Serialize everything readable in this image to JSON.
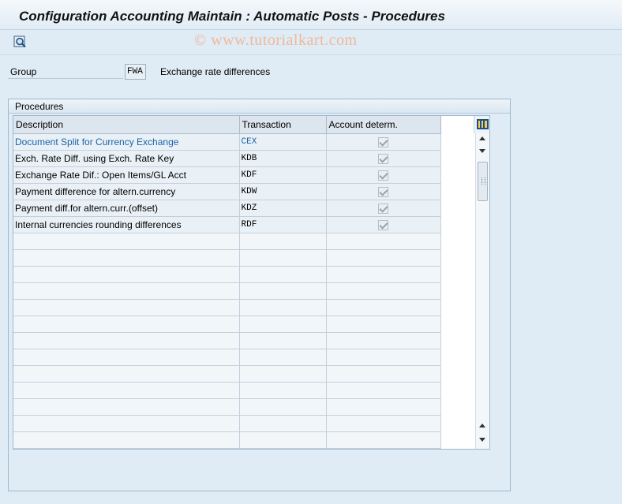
{
  "window": {
    "title": "Configuration Accounting Maintain : Automatic Posts - Procedures"
  },
  "toolbar": {
    "watermark": "© www.tutorialkart.com",
    "details_icon": "magnifier-details-icon"
  },
  "group": {
    "label": "Group",
    "value": "FWA",
    "description": "Exchange rate differences"
  },
  "procedures": {
    "title": "Procedures",
    "columns": [
      "Description",
      "Transaction",
      "Account determ."
    ],
    "rows": [
      {
        "description": "Document Split for Currency Exchange",
        "transaction": "CEX",
        "account_determ": true
      },
      {
        "description": "Exch. Rate Diff. using Exch. Rate Key",
        "transaction": "KDB",
        "account_determ": true
      },
      {
        "description": "Exchange Rate Dif.: Open Items/GL Acct",
        "transaction": "KDF",
        "account_determ": true
      },
      {
        "description": "Payment difference for altern.currency",
        "transaction": "KDW",
        "account_determ": true
      },
      {
        "description": "Payment diff.for altern.curr.(offset)",
        "transaction": "KDZ",
        "account_determ": true
      },
      {
        "description": "Internal currencies rounding differences",
        "transaction": "RDF",
        "account_determ": true
      }
    ],
    "column_settings_icon": "column-settings-icon"
  },
  "colors": {
    "link": "#1d62a6",
    "background": "#dfebf5",
    "watermark": "#f0b99a"
  }
}
